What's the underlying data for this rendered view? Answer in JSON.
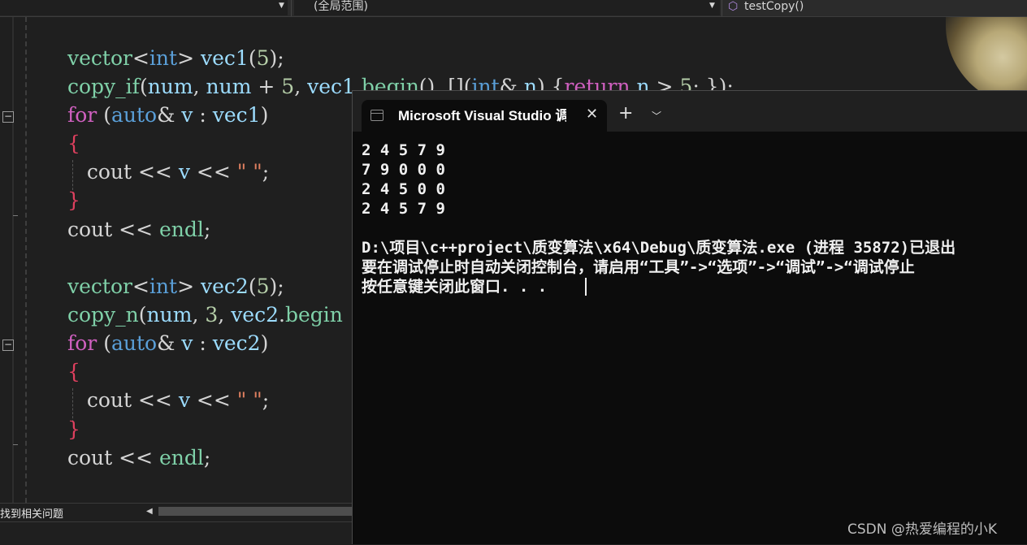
{
  "navbar": {
    "scope": "(全局范围)",
    "function_name": "testCopy()"
  },
  "code": [
    {
      "tokens": [
        [
          "fn",
          "vector"
        ],
        [
          "pun",
          "<"
        ],
        [
          "ty",
          "int"
        ],
        [
          "pun",
          "> "
        ],
        [
          "var",
          "vec1"
        ],
        [
          "pun",
          "("
        ],
        [
          "num",
          "5"
        ],
        [
          "pun",
          ");"
        ]
      ]
    },
    {
      "tokens": [
        [
          "fn",
          "copy_if"
        ],
        [
          "pun",
          "("
        ],
        [
          "var",
          "num"
        ],
        [
          "pun",
          ", "
        ],
        [
          "var",
          "num"
        ],
        [
          "pun",
          " + "
        ],
        [
          "num",
          "5"
        ],
        [
          "pun",
          ", "
        ],
        [
          "var",
          "vec1"
        ],
        [
          "pun",
          "."
        ],
        [
          "fn",
          "begin"
        ],
        [
          "pun",
          "(), []("
        ],
        [
          "ty",
          "int"
        ],
        [
          "pun",
          "& "
        ],
        [
          "var",
          "n"
        ],
        [
          "pun",
          ") {"
        ],
        [
          "kw",
          "return"
        ],
        [
          "pun",
          " "
        ],
        [
          "var",
          "n"
        ],
        [
          "pun",
          " > "
        ],
        [
          "num",
          "5"
        ],
        [
          "pun",
          "; });"
        ]
      ]
    },
    {
      "tokens": [
        [
          "kw",
          "for"
        ],
        [
          "pun",
          " ("
        ],
        [
          "ty",
          "auto"
        ],
        [
          "pun",
          "& "
        ],
        [
          "var",
          "v"
        ],
        [
          "pun",
          " : "
        ],
        [
          "var",
          "vec1"
        ],
        [
          "pun",
          ")"
        ]
      ]
    },
    {
      "tokens": [
        [
          "brace",
          "{"
        ]
      ]
    },
    {
      "tokens": [
        [
          "pun",
          "   cout << "
        ],
        [
          "var",
          "v"
        ],
        [
          "pun",
          " << "
        ],
        [
          "str",
          "\" \""
        ],
        [
          "pun",
          ";"
        ]
      ]
    },
    {
      "tokens": [
        [
          "brace",
          "}"
        ]
      ]
    },
    {
      "tokens": [
        [
          "pun",
          "cout << "
        ],
        [
          "fn",
          "endl"
        ],
        [
          "pun",
          ";"
        ]
      ]
    },
    {
      "tokens": []
    },
    {
      "tokens": [
        [
          "fn",
          "vector"
        ],
        [
          "pun",
          "<"
        ],
        [
          "ty",
          "int"
        ],
        [
          "pun",
          "> "
        ],
        [
          "var",
          "vec2"
        ],
        [
          "pun",
          "("
        ],
        [
          "num",
          "5"
        ],
        [
          "pun",
          ");"
        ]
      ]
    },
    {
      "tokens": [
        [
          "fn",
          "copy_n"
        ],
        [
          "pun",
          "("
        ],
        [
          "var",
          "num"
        ],
        [
          "pun",
          ", "
        ],
        [
          "num",
          "3"
        ],
        [
          "pun",
          ", "
        ],
        [
          "var",
          "vec2"
        ],
        [
          "pun",
          "."
        ],
        [
          "fn",
          "begin"
        ]
      ]
    },
    {
      "tokens": [
        [
          "kw",
          "for"
        ],
        [
          "pun",
          " ("
        ],
        [
          "ty",
          "auto"
        ],
        [
          "pun",
          "& "
        ],
        [
          "var",
          "v"
        ],
        [
          "pun",
          " : "
        ],
        [
          "var",
          "vec2"
        ],
        [
          "pun",
          ")"
        ]
      ]
    },
    {
      "tokens": [
        [
          "brace",
          "{"
        ]
      ]
    },
    {
      "tokens": [
        [
          "pun",
          "   cout << "
        ],
        [
          "var",
          "v"
        ],
        [
          "pun",
          " << "
        ],
        [
          "str",
          "\" \""
        ],
        [
          "pun",
          ";"
        ]
      ]
    },
    {
      "tokens": [
        [
          "brace",
          "}"
        ]
      ]
    },
    {
      "tokens": [
        [
          "pun",
          "cout << "
        ],
        [
          "fn",
          "endl"
        ],
        [
          "pun",
          ";"
        ]
      ]
    }
  ],
  "status": {
    "issues_text": "找到相关问题"
  },
  "console": {
    "tab_title": "Microsoft Visual Studio 调试控制台",
    "tab_close": "✕",
    "new_tab": "+",
    "dropdown": "﹀",
    "lines": [
      "2 4 5 7 9",
      "7 9 0 0 0",
      "2 4 5 0 0",
      "2 4 5 7 9",
      "",
      "D:\\项目\\c++project\\质变算法\\x64\\Debug\\质变算法.exe (进程 35872)已退出",
      "要在调试停止时自动关闭控制台，请启用“工具”->“选项”->“调试”->“调试停止",
      "按任意键关闭此窗口. . ."
    ]
  },
  "watermark": "CSDN @热爱编程的小K"
}
